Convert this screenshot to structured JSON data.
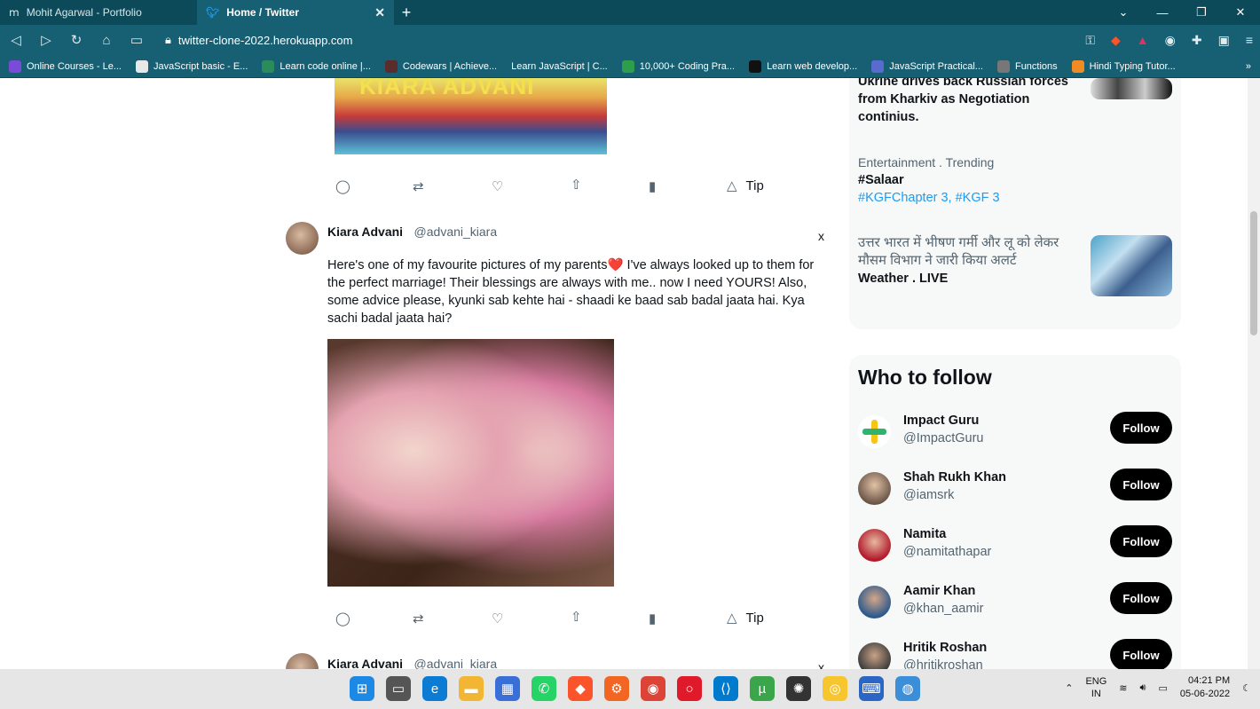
{
  "browser": {
    "tabs": [
      {
        "label": "Mohit Agarwal - Portfolio",
        "active": false
      },
      {
        "label": "Home / Twitter",
        "active": true
      }
    ],
    "url": "twitter-clone-2022.herokuapp.com",
    "bookmarks": [
      "Online Courses - Le...",
      "JavaScript basic - E...",
      "Learn code online |...",
      "Codewars | Achieve...",
      "Learn JavaScript | C...",
      "10,000+ Coding Pra...",
      "Learn web develop...",
      "JavaScript Practical...",
      "Functions",
      "Hindi Typing Tutor..."
    ]
  },
  "feed": {
    "top_media_text": "KIARA ADVANI",
    "actions": {
      "tip_label": "Tip"
    },
    "tweet": {
      "name": "Kiara Advani",
      "handle": "@advani_kiara",
      "close": "x",
      "text": "Here's one of my favourite pictures of my parents❤️ I've always looked up to them for the perfect marriage! Their blessings are always with me.. now I need YOURS! Also, some advice please, kyunki sab kehte hai - shaadi ke baad sab badal jaata hai. Kya sachi badal jaata hai?"
    },
    "next_tweet": {
      "name": "Kiara Advani",
      "handle": "@advani_kiara",
      "close": "x"
    }
  },
  "trends": {
    "partial_title_line1": "Ukrine drives back Russian forces",
    "partial_title_line2": "from Kharkiv as Negotiation",
    "partial_title_line3": "continius.",
    "item2": {
      "category": "Entertainment . Trending",
      "title": "#Salaar",
      "tags": "#KGFChapter 3, #KGF 3"
    },
    "item3": {
      "line1": "उत्तर भारत में भीषण गर्मी और लू को लेकर",
      "line2": "मौसम विभाग ने जारी किया अलर्ट",
      "category": "Weather . LIVE"
    }
  },
  "who_to_follow": {
    "title": "Who to follow",
    "follow_label": "Follow",
    "accounts": [
      {
        "name": "Impact Guru",
        "handle": "@ImpactGuru"
      },
      {
        "name": "Shah Rukh Khan",
        "handle": "@iamsrk"
      },
      {
        "name": "Namita",
        "handle": "@namitathapar"
      },
      {
        "name": "Aamir Khan",
        "handle": "@khan_aamir"
      },
      {
        "name": "Hritik Roshan",
        "handle": "@hritikroshan"
      }
    ]
  },
  "taskbar": {
    "lang_line1": "ENG",
    "lang_line2": "IN",
    "time": "04:21 PM",
    "date": "05-06-2022"
  },
  "colors": {
    "accent": "#1d9bf0",
    "chrome": "#175f72",
    "follow_bg": "#000000"
  }
}
